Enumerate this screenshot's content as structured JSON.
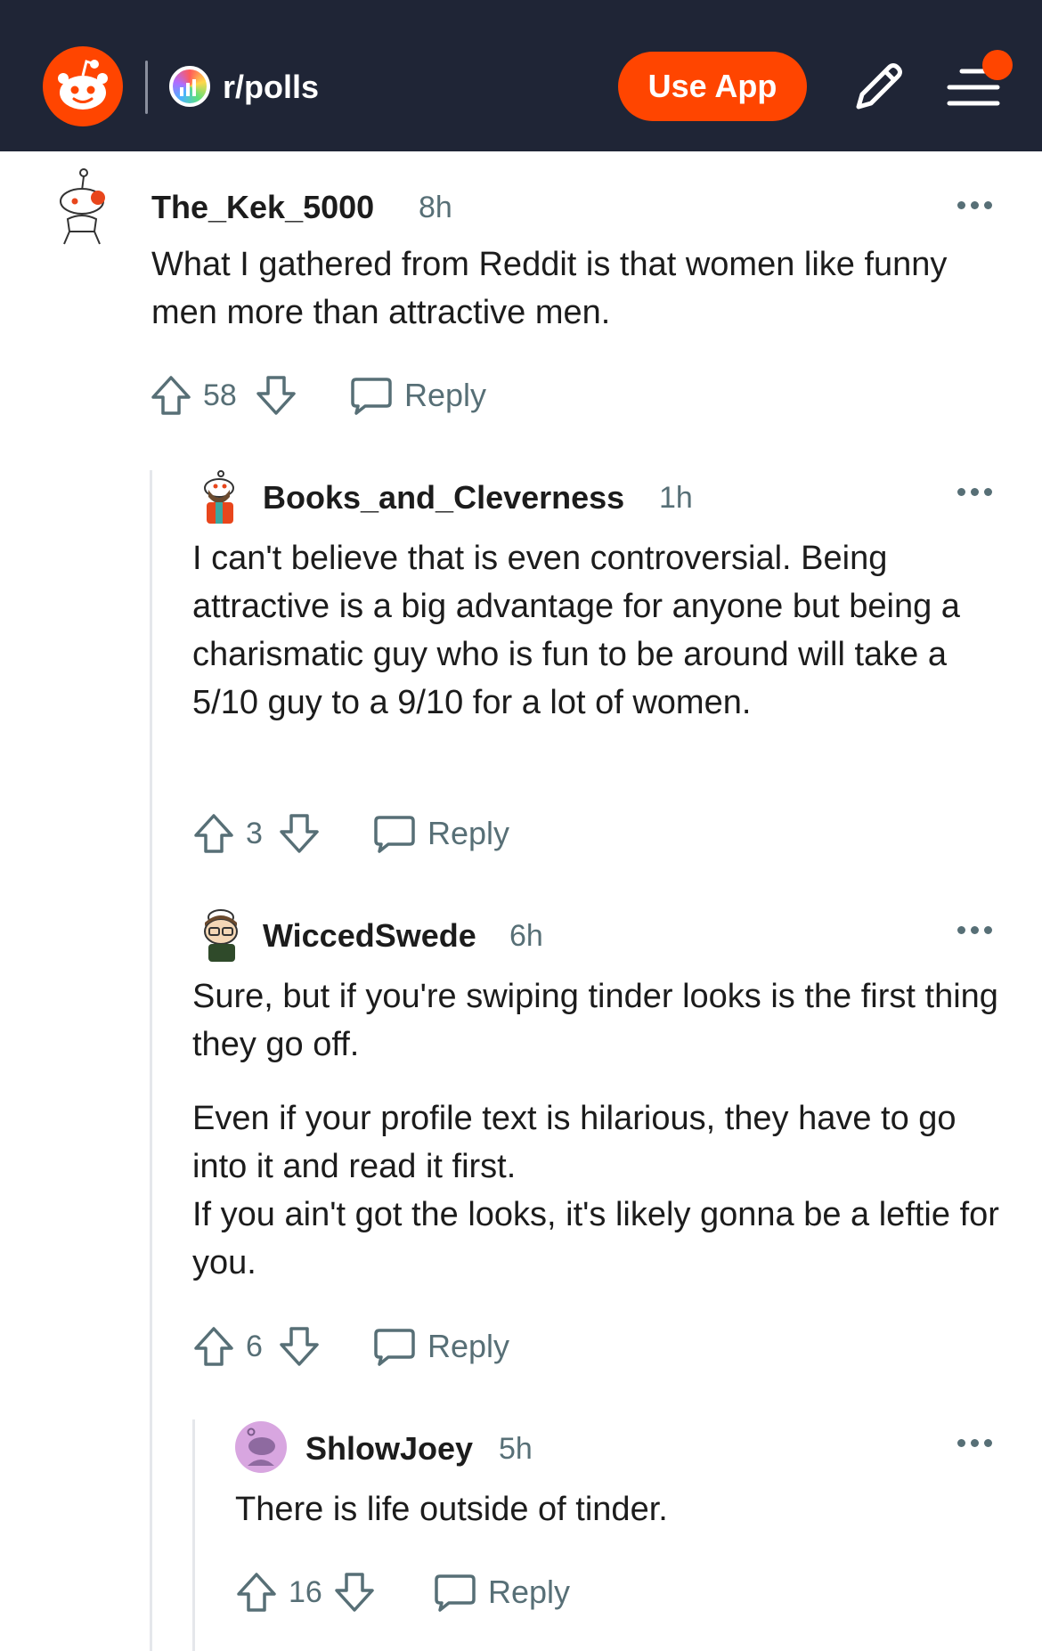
{
  "header": {
    "subreddit": "r/polls",
    "use_app_label": "Use App",
    "icons": [
      "reddit-logo-icon",
      "subreddit-icon",
      "pencil-icon",
      "menu-icon"
    ],
    "brand_color": "#ff4500",
    "header_bg": "#1f2536"
  },
  "comments": [
    {
      "username": "The_Kek_5000",
      "time": "8h",
      "text": "What I gathered from Reddit is that women like funny men more than attractive men.",
      "score": "58",
      "reply_label": "Reply"
    },
    {
      "username": "Books_and_Cleverness",
      "time": "1h",
      "text": "I can't believe that is even controversial. Being attractive is a big advantage for anyone but being a charismatic guy who is fun to be around will take a 5/10 guy to a 9/10 for a lot of women.",
      "score": "3",
      "reply_label": "Reply"
    },
    {
      "username": "WiccedSwede",
      "time": "6h",
      "text_p1": "Sure, but if you're swiping tinder looks is the first thing they go off.",
      "text_p2_line1": "Even if your profile text is hilarious, they have to go into it and read it first.",
      "text_p2_line2": "If you ain't got the looks, it's likely gonna be a leftie for you.",
      "score": "6",
      "reply_label": "Reply"
    },
    {
      "username": "ShlowJoey",
      "time": "5h",
      "text": "There is life outside of tinder.",
      "score": "16",
      "reply_label": "Reply"
    }
  ]
}
